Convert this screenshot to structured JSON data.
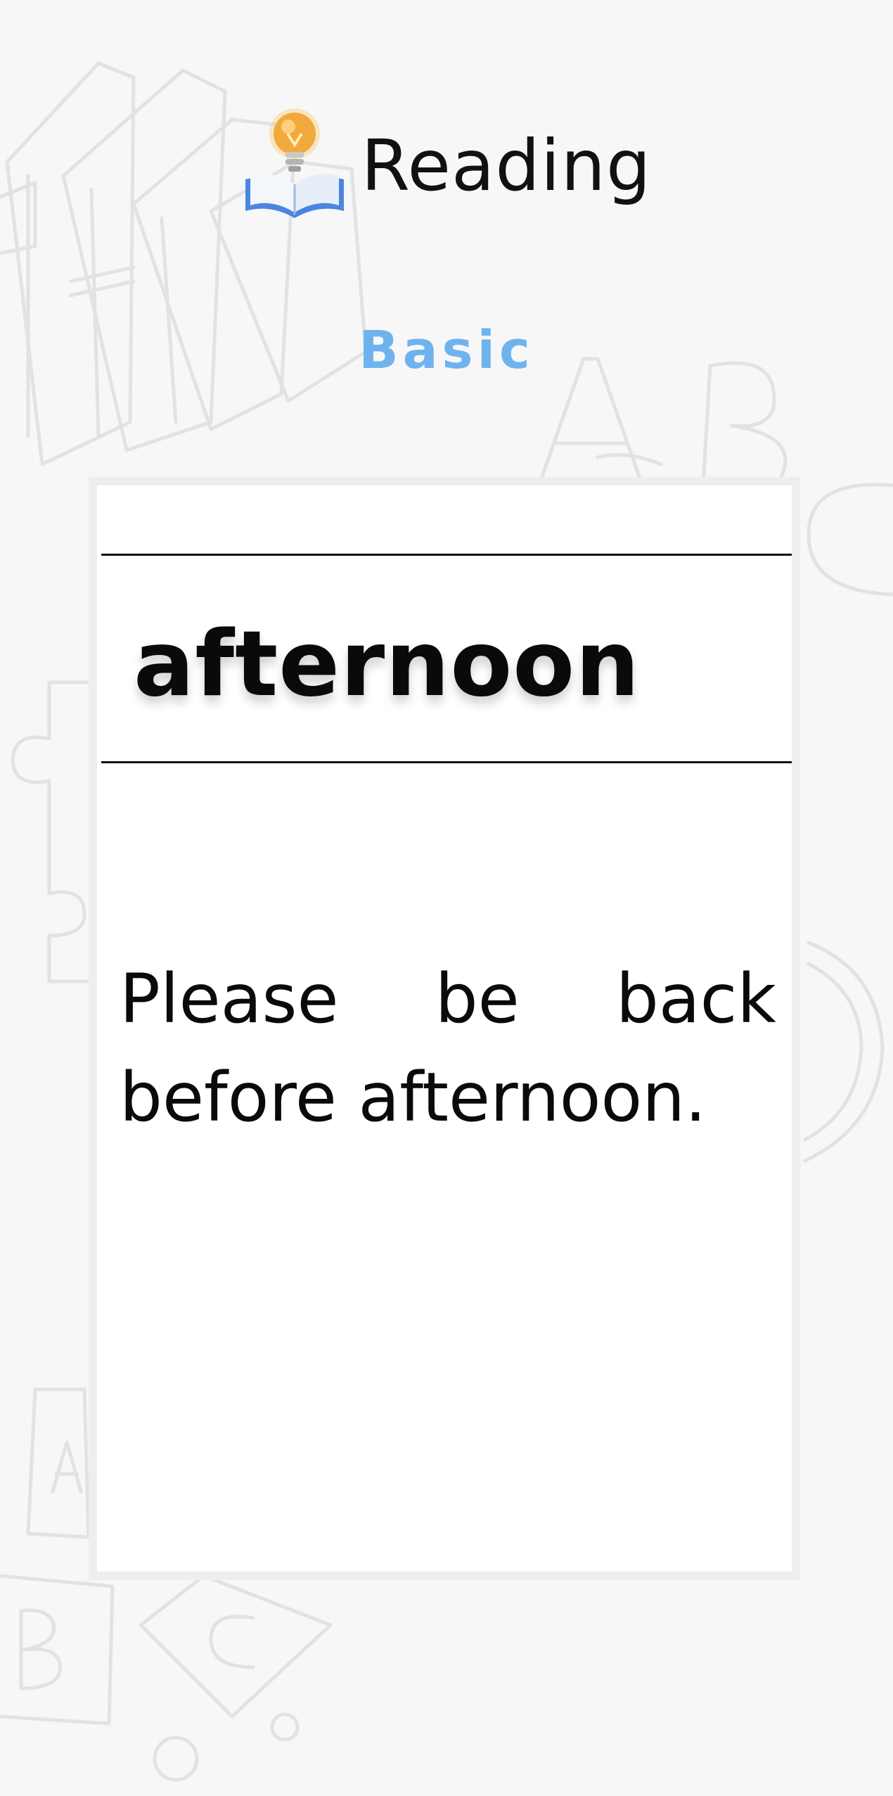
{
  "header": {
    "logo_icon": "lightbulb-book-icon",
    "title": "Reading"
  },
  "level": {
    "label": "Basic",
    "color": "#6fb3ee"
  },
  "card": {
    "word": "afternoon",
    "sentence": "Please be back before afternoon."
  },
  "background": {
    "decorations": [
      "books-icon",
      "letter-a-icon",
      "letter-b-icon",
      "letter-c-icon",
      "puzzle-piece-icon",
      "alphabet-blocks-icon"
    ]
  }
}
